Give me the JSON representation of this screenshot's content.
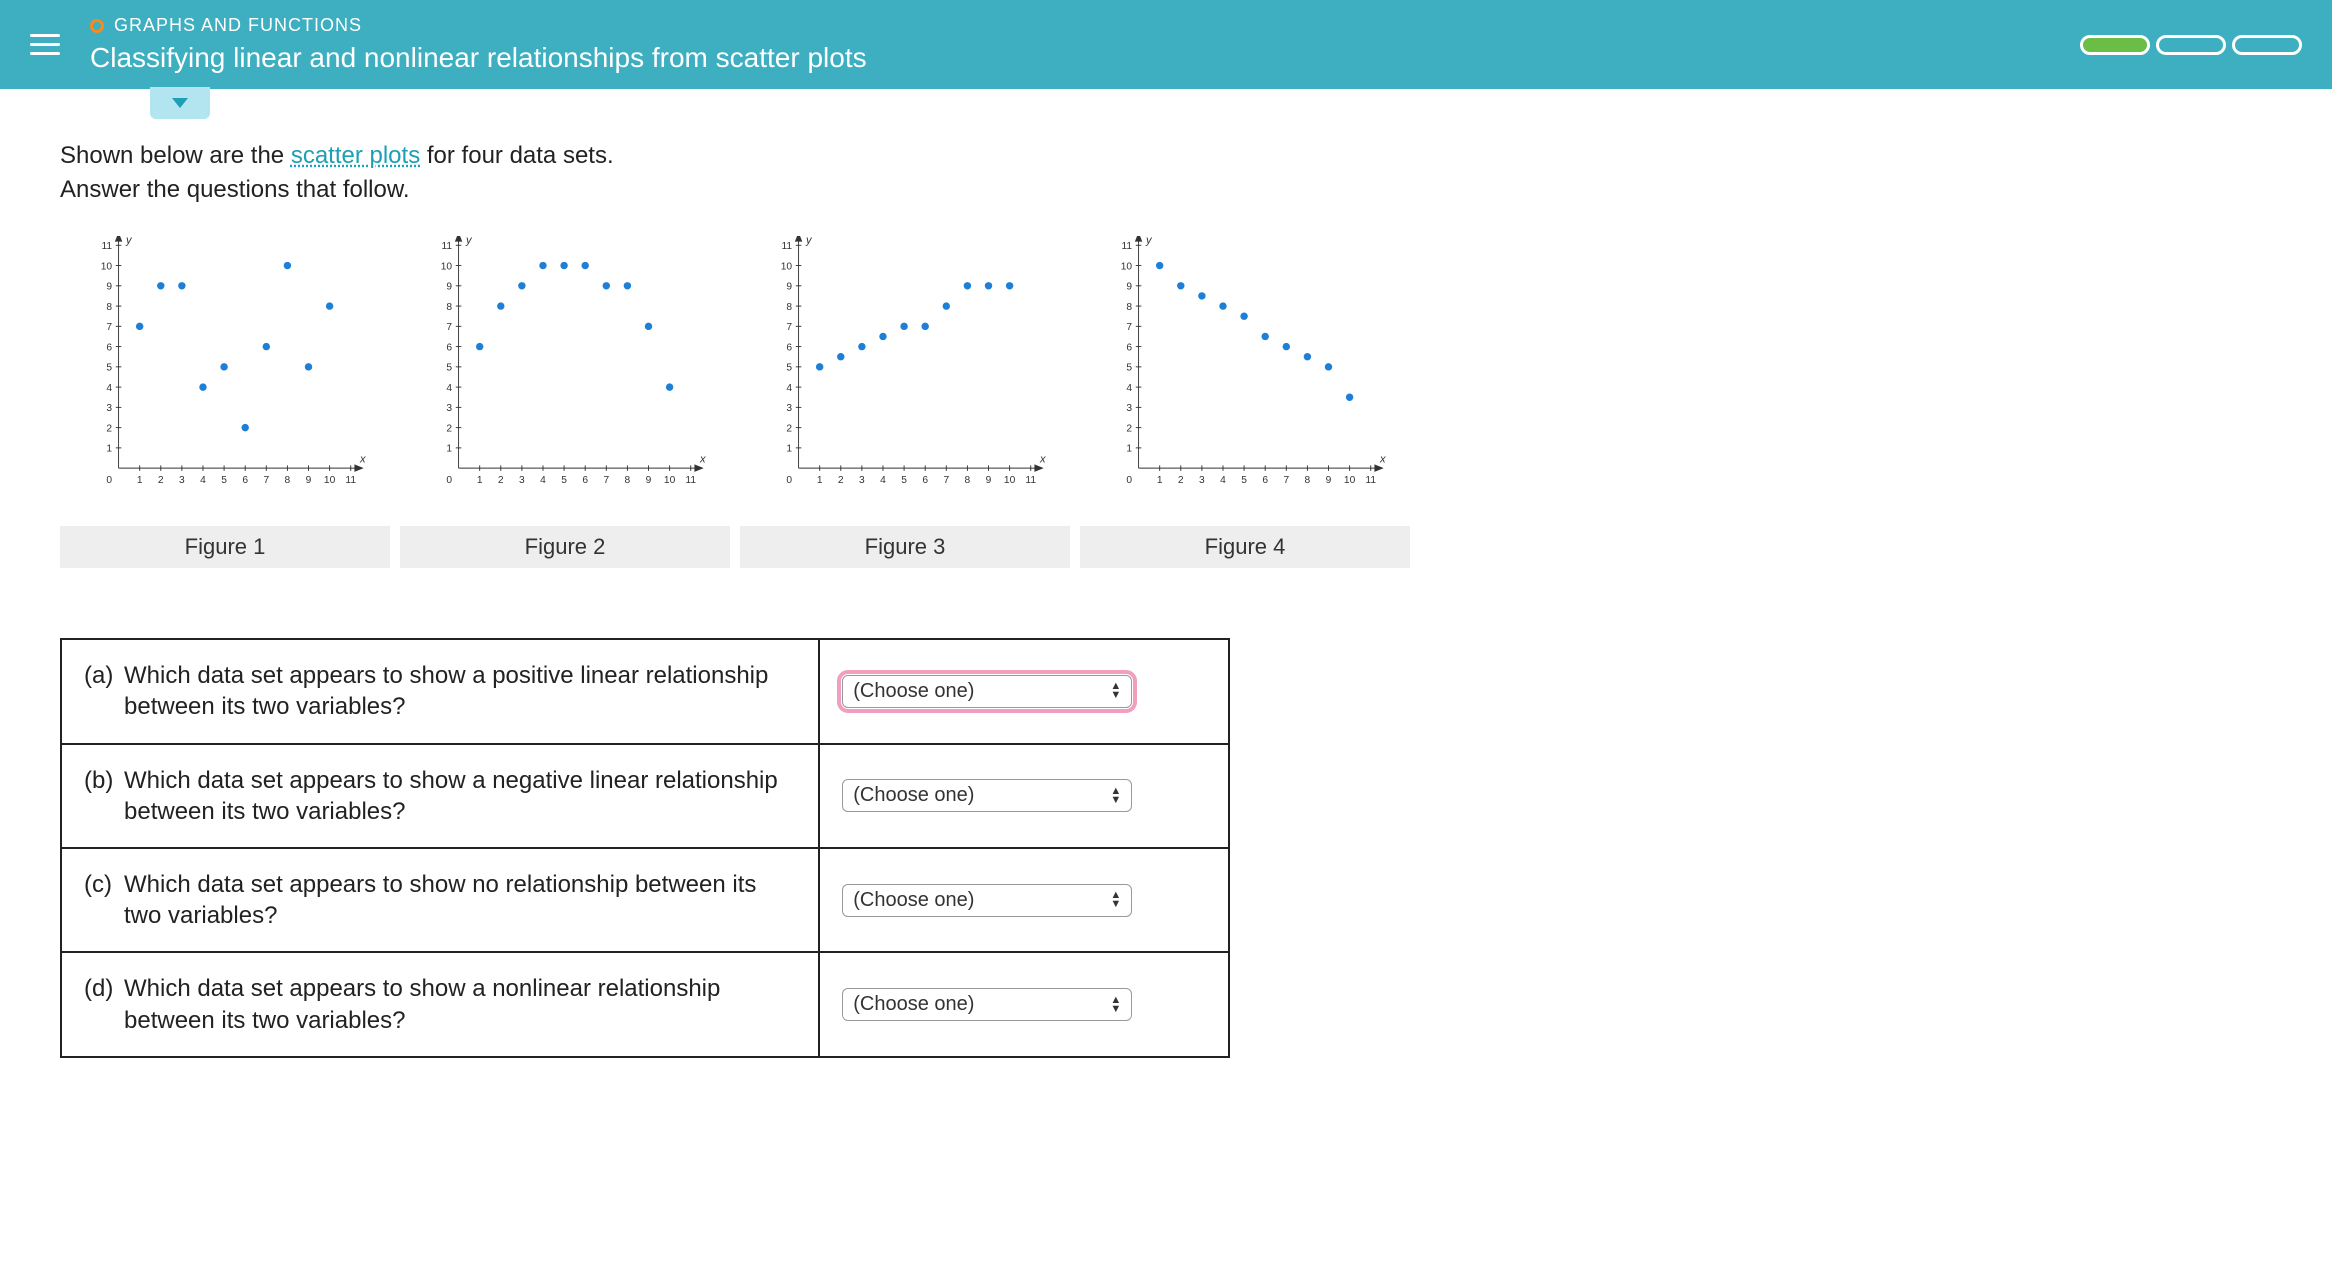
{
  "header": {
    "category": "GRAPHS AND FUNCTIONS",
    "title": "Classifying linear and nonlinear relationships from scatter plots"
  },
  "instructions": {
    "line1_pre": "Shown below are the ",
    "link": "scatter plots",
    "line1_post": " for four data sets.",
    "line2": "Answer the questions that follow."
  },
  "chart_data": [
    {
      "type": "scatter",
      "title": "Figure 1",
      "xlabel": "x",
      "ylabel": "y",
      "xlim": [
        0,
        11
      ],
      "ylim": [
        0,
        11
      ],
      "x": [
        1,
        2,
        3,
        4,
        5,
        6,
        7,
        8,
        9,
        10
      ],
      "y": [
        7,
        9,
        9,
        4,
        5,
        2,
        6,
        10,
        5,
        8
      ]
    },
    {
      "type": "scatter",
      "title": "Figure 2",
      "xlabel": "x",
      "ylabel": "y",
      "xlim": [
        0,
        11
      ],
      "ylim": [
        0,
        11
      ],
      "x": [
        1,
        2,
        3,
        4,
        5,
        6,
        7,
        8,
        9,
        10
      ],
      "y": [
        6,
        8,
        9,
        10,
        10,
        10,
        9,
        9,
        7,
        4
      ]
    },
    {
      "type": "scatter",
      "title": "Figure 3",
      "xlabel": "x",
      "ylabel": "y",
      "xlim": [
        0,
        11
      ],
      "ylim": [
        0,
        11
      ],
      "x": [
        1,
        2,
        3,
        4,
        5,
        6,
        7,
        8,
        9,
        10
      ],
      "y": [
        5,
        5.5,
        6,
        6.5,
        7,
        7,
        8,
        9,
        9,
        9
      ]
    },
    {
      "type": "scatter",
      "title": "Figure 4",
      "xlabel": "x",
      "ylabel": "y",
      "xlim": [
        0,
        11
      ],
      "ylim": [
        0,
        11
      ],
      "x": [
        1,
        2,
        3,
        4,
        5,
        6,
        7,
        8,
        9,
        10
      ],
      "y": [
        10,
        9,
        8.5,
        8,
        7.5,
        6.5,
        6,
        5.5,
        5,
        3.5
      ]
    }
  ],
  "questions": [
    {
      "label": "(a)",
      "text": "Which data set appears to show a positive linear relationship between its two variables?",
      "select": "(Choose one)",
      "active": true
    },
    {
      "label": "(b)",
      "text": "Which data set appears to show a negative linear relationship between its two variables?",
      "select": "(Choose one)",
      "active": false
    },
    {
      "label": "(c)",
      "text": "Which data set appears to show no relationship between its two variables?",
      "select": "(Choose one)",
      "active": false
    },
    {
      "label": "(d)",
      "text": "Which data set appears to show a nonlinear relationship between its two variables?",
      "select": "(Choose one)",
      "active": false
    }
  ],
  "axis_ticks": [
    1,
    2,
    3,
    4,
    5,
    6,
    7,
    8,
    9,
    10,
    11
  ]
}
